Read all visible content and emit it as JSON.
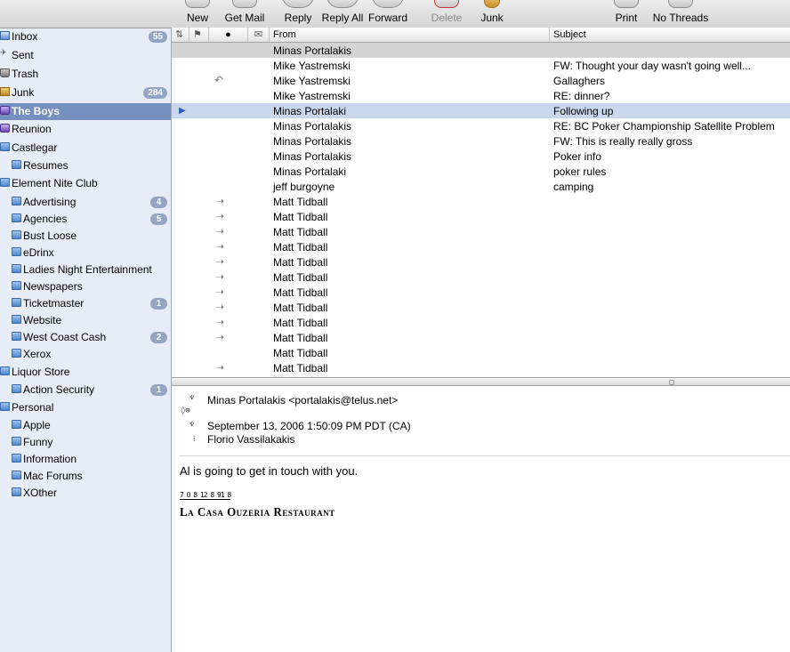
{
  "toolbar": {
    "new": "New",
    "get_mail": "Get Mail",
    "reply": "Reply",
    "reply_all": "Reply All",
    "forward": "Forward",
    "delete": "Delete",
    "junk": "Junk",
    "print": "Print",
    "no_threads": "No Threads"
  },
  "sidebar": {
    "mailboxes": [
      {
        "label": "Inbox",
        "badge": "55",
        "icon": "inbox-icon"
      },
      {
        "label": "Sent",
        "badge": "",
        "icon": "sent-icon"
      },
      {
        "label": "Trash",
        "badge": "",
        "icon": "trash-icon"
      },
      {
        "label": "Junk",
        "badge": "284",
        "icon": "junk-icon"
      },
      {
        "label": "The Boys",
        "badge": "",
        "icon": "smart-mailbox-icon"
      },
      {
        "label": "Reunion",
        "badge": "",
        "icon": "smart-mailbox-icon"
      },
      {
        "label": "Castlegar",
        "badge": "",
        "icon": "folder-icon"
      },
      {
        "label": "Resumes",
        "badge": "",
        "icon": "folder-icon"
      },
      {
        "label": "Element Nite Club",
        "badge": "",
        "icon": "folder-icon"
      },
      {
        "label": "Advertising",
        "badge": "4",
        "icon": "folder-icon"
      },
      {
        "label": "Agencies",
        "badge": "5",
        "icon": "folder-icon"
      },
      {
        "label": "Bust Loose",
        "badge": "",
        "icon": "folder-icon"
      },
      {
        "label": "eDrinx",
        "badge": "",
        "icon": "folder-icon"
      },
      {
        "label": "Ladies Night Entertainment",
        "badge": "",
        "icon": "folder-icon"
      },
      {
        "label": "Newspapers",
        "badge": "",
        "icon": "folder-icon"
      },
      {
        "label": "Ticketmaster",
        "badge": "1",
        "icon": "folder-icon"
      },
      {
        "label": "Website",
        "badge": "",
        "icon": "folder-icon"
      },
      {
        "label": "West Coast Cash",
        "badge": "2",
        "icon": "folder-icon"
      },
      {
        "label": "Xerox",
        "badge": "",
        "icon": "folder-icon"
      },
      {
        "label": "Liquor Store",
        "badge": "",
        "icon": "folder-icon"
      },
      {
        "label": "Action Security",
        "badge": "1",
        "icon": "folder-icon"
      },
      {
        "label": "Personal",
        "badge": "",
        "icon": "folder-icon"
      },
      {
        "label": "Apple",
        "badge": "",
        "icon": "folder-icon"
      },
      {
        "label": "Funny",
        "badge": "",
        "icon": "folder-icon"
      },
      {
        "label": "Information",
        "badge": "",
        "icon": "folder-icon"
      },
      {
        "label": "Mac Forums",
        "badge": "",
        "icon": "folder-icon"
      },
      {
        "label": "XOther",
        "badge": "",
        "icon": "folder-icon"
      }
    ]
  },
  "list": {
    "columns": {
      "from": "From",
      "subject": "Subject"
    },
    "messages": [
      {
        "from": "Minas Portalakis",
        "subject": "",
        "status": ""
      },
      {
        "from": "Mike Yastremski",
        "subject": "FW: Thought your day wasn't going well...",
        "status": ""
      },
      {
        "from": "Mike Yastremski",
        "subject": "Gallaghers",
        "status": "replied"
      },
      {
        "from": "Mike Yastremski",
        "subject": "RE: dinner?",
        "status": ""
      },
      {
        "from": "Minas Portalaki",
        "subject": "Following up",
        "status": "current"
      },
      {
        "from": "Minas Portalakis",
        "subject": "RE: BC Poker Championship Satellite Problem",
        "status": ""
      },
      {
        "from": "Minas Portalakis",
        "subject": "FW: This is really really gross",
        "status": ""
      },
      {
        "from": "Minas Portalakis",
        "subject": "Poker info",
        "status": ""
      },
      {
        "from": "Minas Portalaki",
        "subject": "poker rules",
        "status": ""
      },
      {
        "from": "jeff burgoyne",
        "subject": "camping",
        "status": ""
      },
      {
        "from": "Matt Tidball",
        "subject": "",
        "status": "forwarded"
      },
      {
        "from": "Matt Tidball",
        "subject": "",
        "status": "forwarded"
      },
      {
        "from": "Matt Tidball",
        "subject": "",
        "status": "forwarded"
      },
      {
        "from": "Matt Tidball",
        "subject": "",
        "status": "forwarded"
      },
      {
        "from": "Matt Tidball",
        "subject": "",
        "status": "forwarded"
      },
      {
        "from": "Matt Tidball",
        "subject": "",
        "status": "forwarded"
      },
      {
        "from": "Matt Tidball",
        "subject": "",
        "status": "forwarded"
      },
      {
        "from": "Matt Tidball",
        "subject": "",
        "status": "forwarded"
      },
      {
        "from": "Matt Tidball",
        "subject": "",
        "status": "forwarded"
      },
      {
        "from": "Matt Tidball",
        "subject": "",
        "status": "forwarded"
      },
      {
        "from": "Matt Tidball",
        "subject": "",
        "status": ""
      },
      {
        "from": "Matt Tidball",
        "subject": "",
        "status": "forwarded"
      }
    ]
  },
  "preview": {
    "from": "Minas Portalakis <portalakis@telus.net>",
    "date": "September 13, 2006 1:50:09 PM PDT (CA)",
    "to": "Florio Vassilakakis",
    "body": "Al is going to get in touch with you.",
    "signature_numbers": "7 0 8 12 8 91 8",
    "signature": "La Casa Ouzeria Restaurant"
  },
  "colors": {
    "sidebar_bg": "#e7edf6",
    "sidebar_selected": "#7590bf",
    "row_selected": "#cad8ee",
    "row_grey": "#d4d4d4",
    "badge": "#93a5c0"
  }
}
